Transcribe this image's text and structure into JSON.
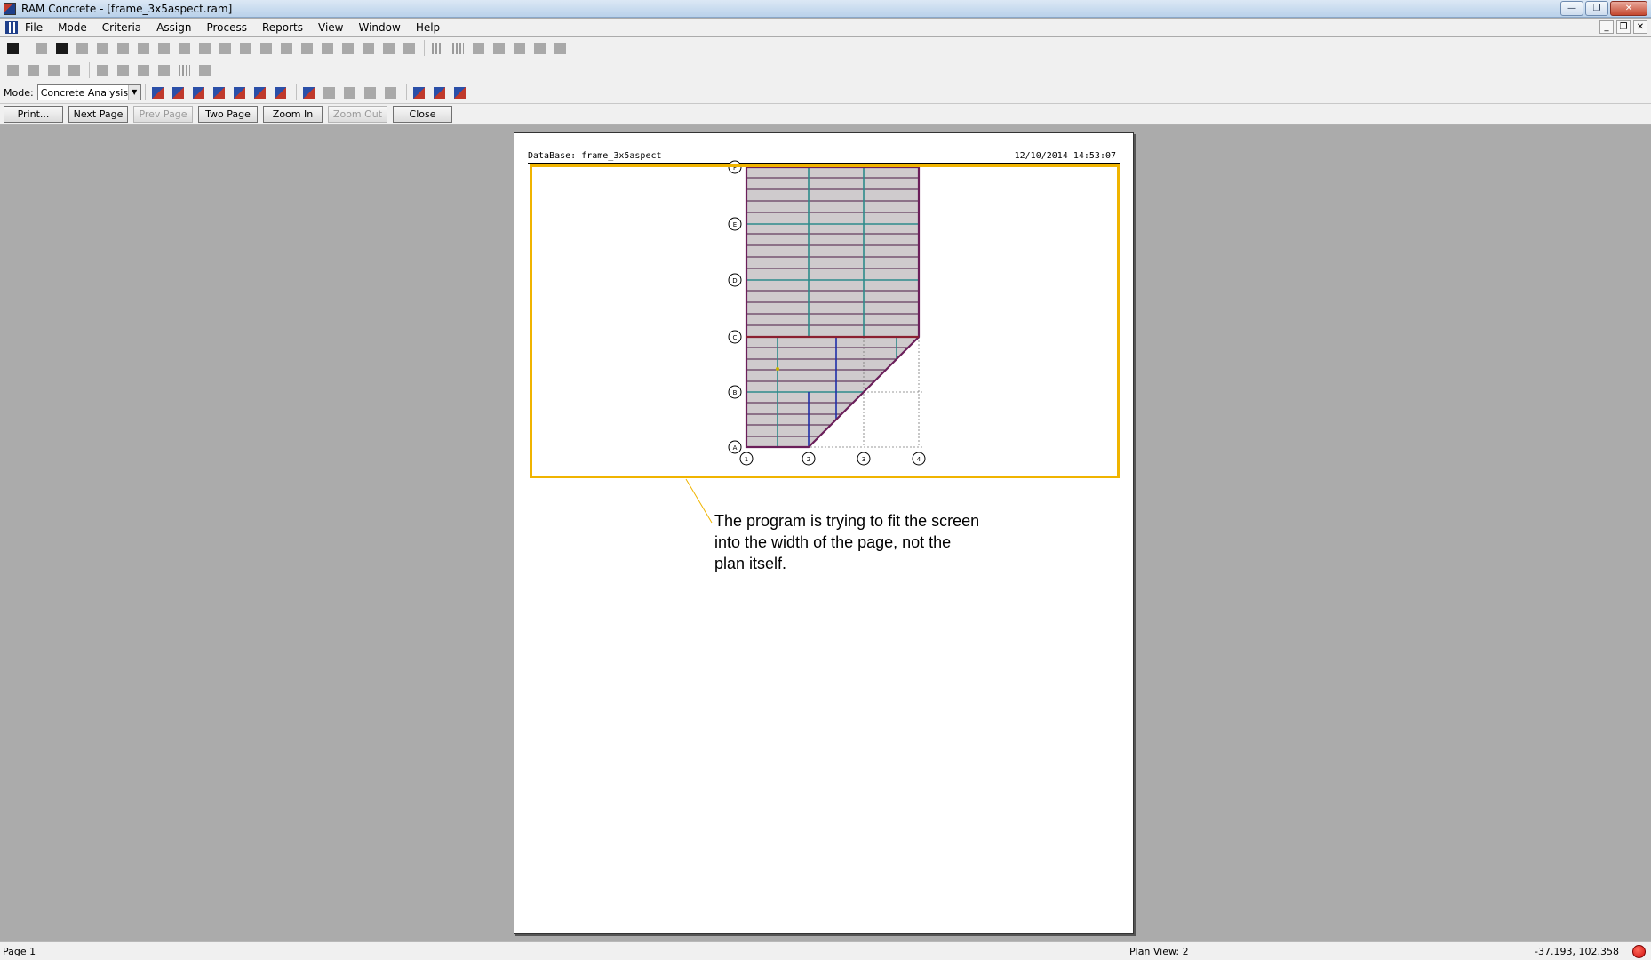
{
  "window": {
    "title": "RAM Concrete - [frame_3x5aspect.ram]"
  },
  "menu": {
    "items": [
      "File",
      "Mode",
      "Criteria",
      "Assign",
      "Process",
      "Reports",
      "View",
      "Window",
      "Help"
    ]
  },
  "mode_bar": {
    "label": "Mode:",
    "selected_mode": "Concrete Analysis"
  },
  "preview_buttons": {
    "print": "Print...",
    "next_page": "Next Page",
    "prev_page": "Prev Page",
    "two_page": "Two Page",
    "zoom_in": "Zoom In",
    "zoom_out": "Zoom Out",
    "close": "Close"
  },
  "paper": {
    "database_label": "DataBase:  frame_3x5aspect",
    "timestamp": "12/10/2014 14:53:07",
    "grid_rows": [
      "F",
      "E",
      "D",
      "C",
      "B",
      "A"
    ],
    "grid_cols": [
      "1",
      "2",
      "3",
      "4"
    ],
    "annotation": "The program is trying to fit the screen into the width of the page, not the plan itself."
  },
  "status": {
    "page": "Page 1",
    "plan_view": "Plan View: 2",
    "coordinates": "-37.193,  102.358"
  },
  "colors": {
    "highlight": "#f0b400",
    "slab_fill": "#cfcbcd",
    "beam_purple": "#6b1f5a",
    "beam_teal": "#2e8b8b",
    "beam_blue": "#1f2fa8"
  }
}
